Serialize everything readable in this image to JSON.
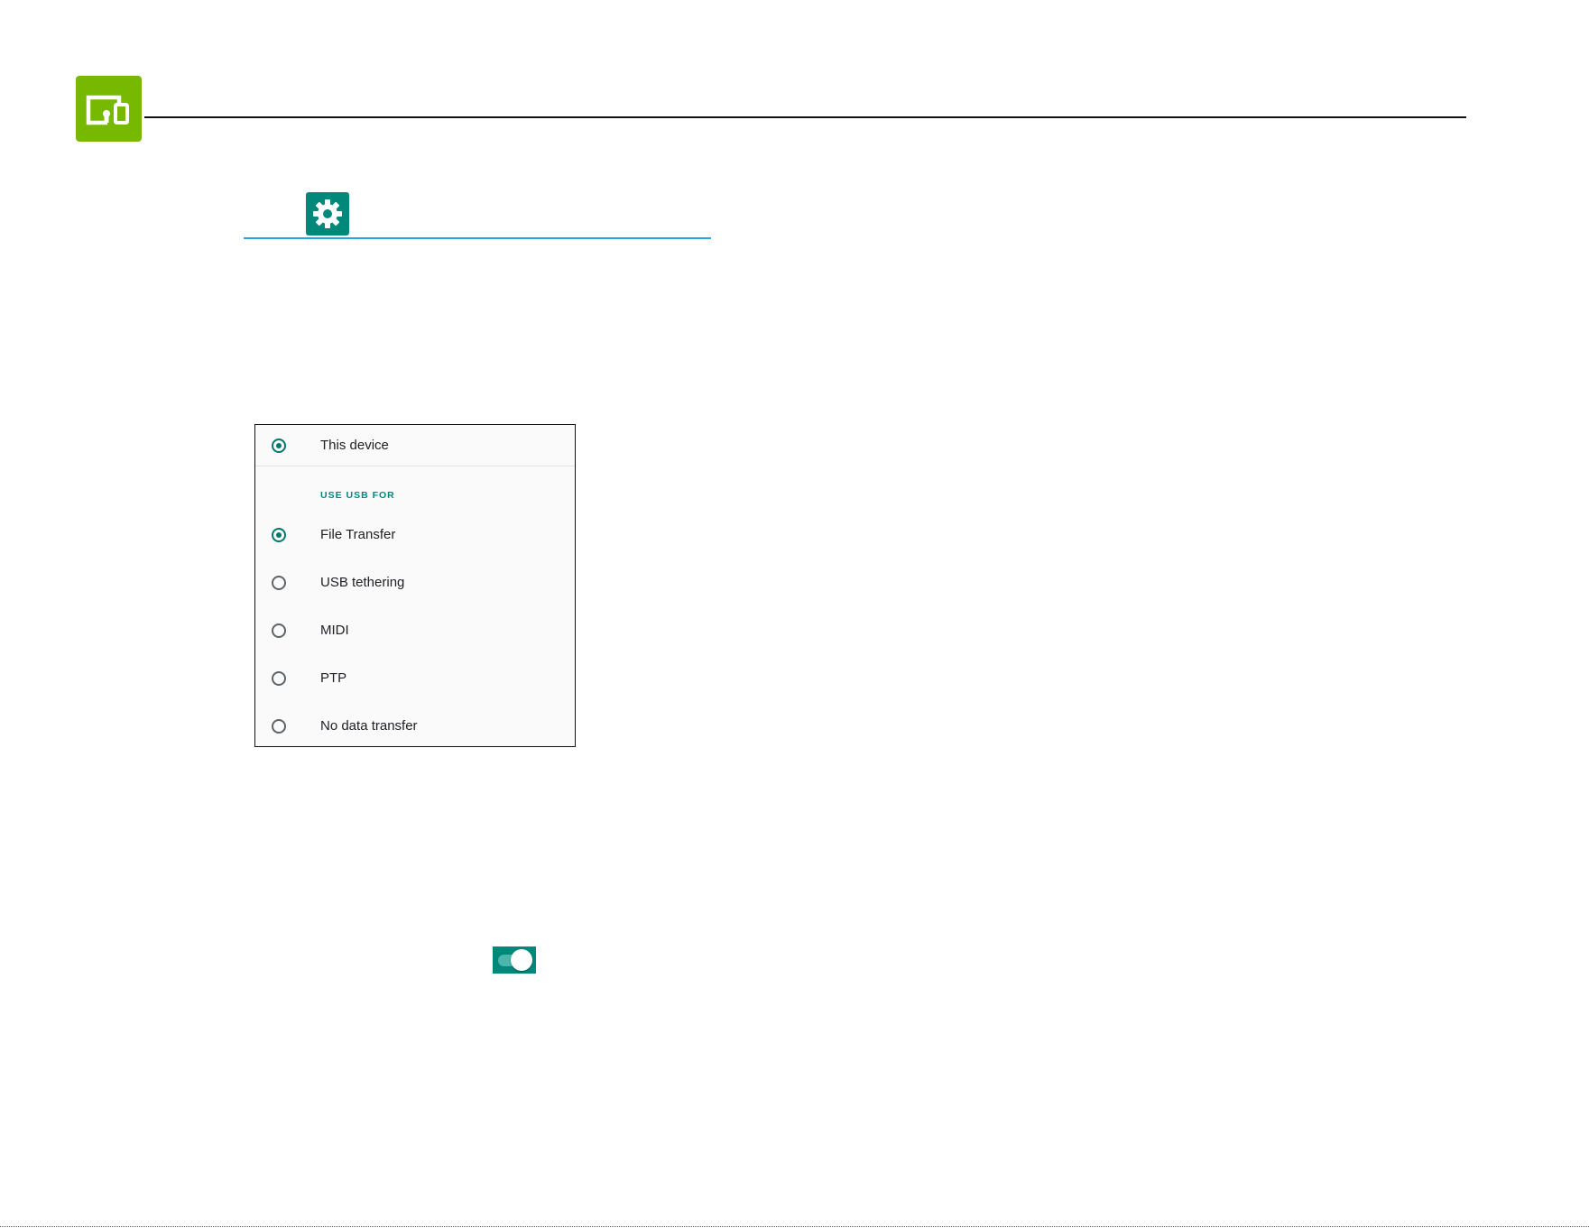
{
  "header": {
    "icon": "devices-icon",
    "icon_color": "#76b900"
  },
  "settings_section": {
    "icon": "gear-icon",
    "icon_color": "#00897b",
    "rule_color": "#29a8e0"
  },
  "usb_panel": {
    "device_option": {
      "label": "This device",
      "selected": true
    },
    "section_header": "USE USB FOR",
    "options": [
      {
        "label": "File Transfer",
        "selected": true
      },
      {
        "label": "USB tethering",
        "selected": false
      },
      {
        "label": "MIDI",
        "selected": false
      },
      {
        "label": "PTP",
        "selected": false
      },
      {
        "label": "No data transfer",
        "selected": false
      }
    ],
    "accent_color": "#00796b"
  },
  "toggle": {
    "state": "on",
    "color": "#00897b"
  }
}
